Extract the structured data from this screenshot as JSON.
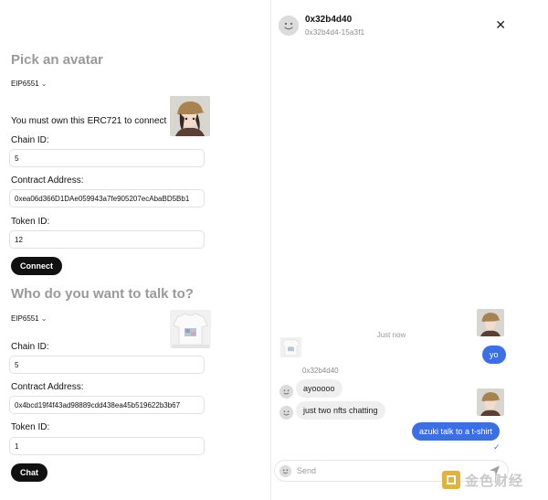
{
  "left": {
    "section1": {
      "title": "Pick an avatar",
      "standard": "EIP6551",
      "notice": "You must own this ERC721 to connect",
      "chain_label": "Chain ID:",
      "chain_value": "5",
      "contract_label": "Contract Address:",
      "contract_value": "0xea06d366D1DAe059943a7fe905207ecAbaBD5Bb1",
      "token_label": "Token ID:",
      "token_value": "12",
      "button": "Connect"
    },
    "section2": {
      "title": "Who do you want to talk to?",
      "standard": "EIP6551",
      "chain_label": "Chain ID:",
      "chain_value": "5",
      "contract_label": "Contract Address:",
      "contract_value": "0x4bcd19f4f43ad98889cdd438ea45b519622b3b67",
      "token_label": "Token ID:",
      "token_value": "1",
      "button": "Chat"
    }
  },
  "chat": {
    "name": "0x32b4d40",
    "subtitle": "0x32b4d4-15a3f1",
    "close_glyph": "✕",
    "timestamp": "Just now",
    "sender": "0x32b4d40",
    "messages": [
      {
        "text": "yo",
        "dir": "out"
      },
      {
        "text": "ayooooo",
        "dir": "in"
      },
      {
        "text": "just two nfts chatting",
        "dir": "in"
      },
      {
        "text": "azuki talk to a t-shirt",
        "dir": "out"
      }
    ],
    "read_receipt": "✓",
    "composer_placeholder": "Send"
  },
  "watermark": {
    "text": "金色财经"
  },
  "colors": {
    "accent": "#3b6fe6",
    "button_dark": "#111111",
    "heading_grey": "#9a9a9a"
  }
}
